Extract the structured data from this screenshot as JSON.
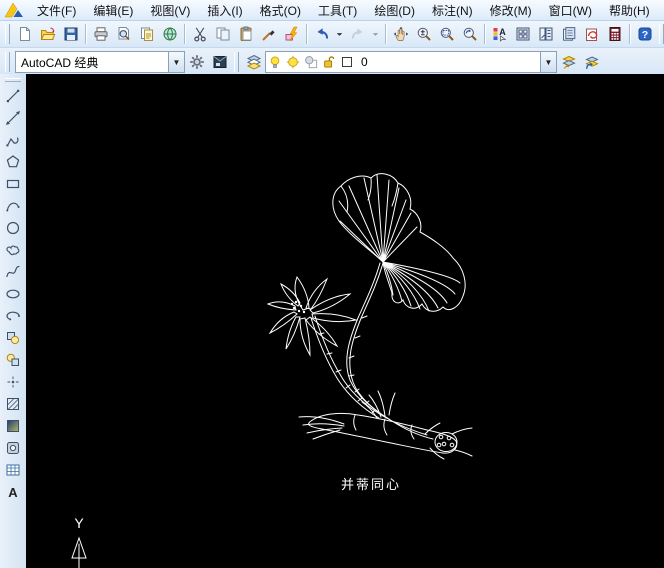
{
  "menu": {
    "items": [
      {
        "label": "文件(F)",
        "name": "menu-file"
      },
      {
        "label": "编辑(E)",
        "name": "menu-edit"
      },
      {
        "label": "视图(V)",
        "name": "menu-view"
      },
      {
        "label": "插入(I)",
        "name": "menu-insert"
      },
      {
        "label": "格式(O)",
        "name": "menu-format"
      },
      {
        "label": "工具(T)",
        "name": "menu-tools"
      },
      {
        "label": "绘图(D)",
        "name": "menu-draw"
      },
      {
        "label": "标注(N)",
        "name": "menu-dimension"
      },
      {
        "label": "修改(M)",
        "name": "menu-modify"
      },
      {
        "label": "窗口(W)",
        "name": "menu-window"
      },
      {
        "label": "帮助(H)",
        "name": "menu-help"
      }
    ]
  },
  "standard_toolbar": {
    "buttons": [
      {
        "icon": "new-file",
        "name": "new-file"
      },
      {
        "icon": "open-file",
        "name": "open-file"
      },
      {
        "icon": "save",
        "name": "save"
      },
      {
        "sep": true
      },
      {
        "icon": "plot",
        "name": "plot"
      },
      {
        "icon": "plot-preview",
        "name": "plot-preview"
      },
      {
        "icon": "publish",
        "name": "publish"
      },
      {
        "icon": "etransmit",
        "name": "etransmit"
      },
      {
        "sep": true
      },
      {
        "icon": "cut",
        "name": "cut"
      },
      {
        "icon": "copy",
        "name": "copy"
      },
      {
        "icon": "paste",
        "name": "paste"
      },
      {
        "icon": "match-properties",
        "name": "match-properties"
      },
      {
        "icon": "block-editor",
        "name": "block-editor"
      },
      {
        "sep": true
      },
      {
        "icon": "undo",
        "name": "undo"
      },
      {
        "icon": "drop",
        "name": "undo-dropdown",
        "cls": "narrow"
      },
      {
        "icon": "redo",
        "name": "redo",
        "disabled": true
      },
      {
        "icon": "drop",
        "name": "redo-dropdown",
        "cls": "narrow",
        "disabled": true
      },
      {
        "sep": true
      },
      {
        "icon": "pan",
        "name": "pan-realtime"
      },
      {
        "icon": "zoom-realtime",
        "name": "zoom-realtime"
      },
      {
        "icon": "zoom-window",
        "name": "zoom-window"
      },
      {
        "icon": "zoom-previous",
        "name": "zoom-previous"
      },
      {
        "sep": true
      },
      {
        "icon": "properties",
        "name": "properties-palette"
      },
      {
        "icon": "designcenter",
        "name": "designcenter"
      },
      {
        "icon": "tool-palettes",
        "name": "tool-palettes"
      },
      {
        "icon": "sheet-set",
        "name": "sheet-set-manager"
      },
      {
        "icon": "markup-set",
        "name": "markup-set-manager"
      },
      {
        "icon": "quickcalc",
        "name": "quickcalc"
      },
      {
        "sep": true
      },
      {
        "icon": "help",
        "name": "help"
      }
    ]
  },
  "workspace_toolbar": {
    "selected": "AutoCAD 经典",
    "buttons": [
      {
        "icon": "workspace-settings",
        "name": "workspace-settings"
      },
      {
        "icon": "save-workspace",
        "name": "save-workspace"
      }
    ]
  },
  "layer_toolbar": {
    "layer_name": "0",
    "manager_button": [
      {
        "icon": "layers-manager",
        "name": "layer-properties-manager"
      }
    ],
    "state_icons": [
      {
        "icon": "bulb",
        "name": "layer-on-toggle",
        "cls": "state"
      },
      {
        "icon": "thaw",
        "name": "layer-thaw-toggle",
        "cls": "state"
      },
      {
        "icon": "freeze-vp",
        "name": "layer-viewport-freeze-toggle",
        "cls": "state"
      },
      {
        "icon": "unlock",
        "name": "layer-lock-toggle",
        "cls": "state"
      },
      {
        "icon": "color-swatch",
        "name": "layer-color-swatch",
        "cls": "state"
      }
    ],
    "right_buttons": [
      {
        "icon": "make-current",
        "name": "make-object-layer-current"
      },
      {
        "icon": "layer-previous",
        "name": "layer-previous"
      }
    ]
  },
  "draw_toolbar": {
    "tools": [
      {
        "icon": "line",
        "name": "draw-line"
      },
      {
        "icon": "construction-line",
        "name": "draw-construction-line"
      },
      {
        "icon": "polyline",
        "name": "draw-polyline"
      },
      {
        "icon": "polygon",
        "name": "draw-polygon"
      },
      {
        "icon": "rectangle",
        "name": "draw-rectangle"
      },
      {
        "icon": "arc",
        "name": "draw-arc"
      },
      {
        "icon": "circle",
        "name": "draw-circle"
      },
      {
        "icon": "revision-cloud",
        "name": "draw-revision-cloud"
      },
      {
        "icon": "spline",
        "name": "draw-spline"
      },
      {
        "icon": "ellipse",
        "name": "draw-ellipse"
      },
      {
        "icon": "ellipse-arc",
        "name": "draw-ellipse-arc"
      },
      {
        "icon": "insert-block",
        "name": "insert-block"
      },
      {
        "icon": "make-block",
        "name": "make-block"
      },
      {
        "icon": "point",
        "name": "draw-point"
      },
      {
        "icon": "hatch",
        "name": "draw-hatch"
      },
      {
        "icon": "gradient",
        "name": "draw-gradient"
      },
      {
        "icon": "region",
        "name": "draw-region"
      },
      {
        "icon": "table",
        "name": "draw-table"
      },
      {
        "icon": "mtext",
        "name": "draw-multiline-text"
      }
    ]
  },
  "canvas": {
    "caption": "并蒂同心",
    "ucs_label": "Y",
    "background": "#000000",
    "line_color": "#ffffff"
  }
}
